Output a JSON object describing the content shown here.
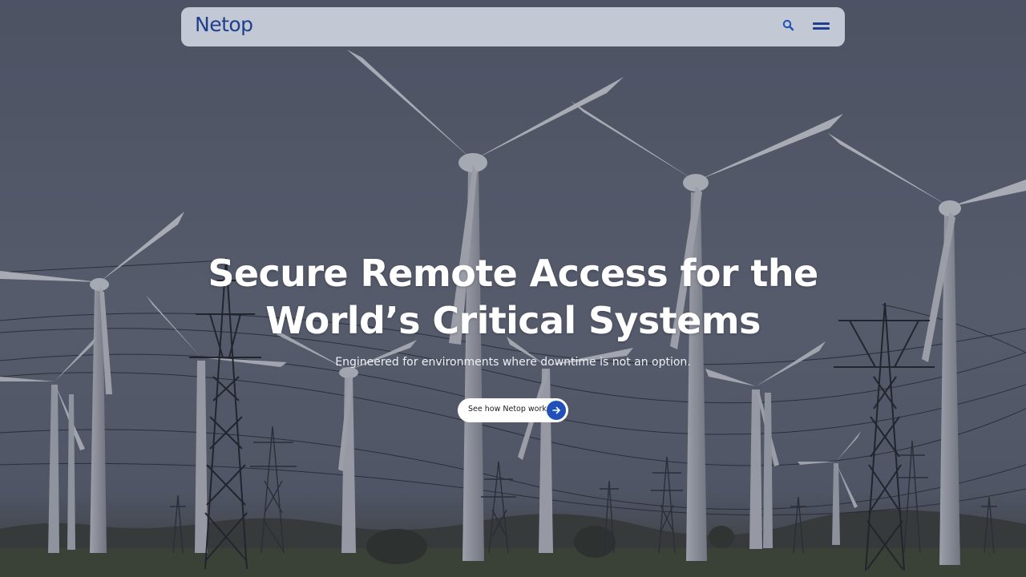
{
  "brand": {
    "name": "Netop",
    "color": "#1f3f8c"
  },
  "nav": {
    "search_icon": "search-icon",
    "menu_icon": "hamburger-menu-icon"
  },
  "hero": {
    "title_line1": "Secure Remote Access for the",
    "title_line2": "World’s Critical Systems",
    "subtitle": "Engineered for environments where downtime is not an option.",
    "cta_label": "See how Netop works",
    "cta_icon": "arrow-right-icon",
    "cta_icon_color": "#2150b8",
    "background": "wind-turbines-and-power-pylons-image"
  }
}
